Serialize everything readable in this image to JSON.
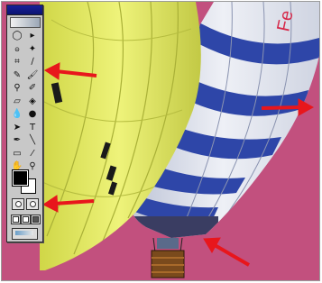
{
  "application": {
    "panel": "tools palette"
  },
  "toolbox": {
    "tools": [
      {
        "name": "marquee-tool-icon",
        "glyph": "◯"
      },
      {
        "name": "move-tool-icon",
        "glyph": "▸"
      },
      {
        "name": "lasso-tool-icon",
        "glyph": "ဓ"
      },
      {
        "name": "magic-wand-tool-icon",
        "glyph": "✦"
      },
      {
        "name": "crop-tool-icon",
        "glyph": "⌗"
      },
      {
        "name": "slice-tool-icon",
        "glyph": "∕"
      },
      {
        "name": "healing-brush-tool-icon",
        "glyph": "✎"
      },
      {
        "name": "brush-tool-icon",
        "glyph": "🖌"
      },
      {
        "name": "clone-stamp-tool-icon",
        "glyph": "⚲"
      },
      {
        "name": "history-brush-tool-icon",
        "glyph": "✐"
      },
      {
        "name": "eraser-tool-icon",
        "glyph": "▱"
      },
      {
        "name": "paint-bucket-tool-icon",
        "glyph": "◈"
      },
      {
        "name": "blur-tool-icon",
        "glyph": "💧"
      },
      {
        "name": "dodge-tool-icon",
        "glyph": "●"
      },
      {
        "name": "path-selection-tool-icon",
        "glyph": "➤"
      },
      {
        "name": "type-tool-icon",
        "glyph": "T"
      },
      {
        "name": "pen-tool-icon",
        "glyph": "✒"
      },
      {
        "name": "line-tool-icon",
        "glyph": "╲"
      },
      {
        "name": "notes-tool-icon",
        "glyph": "▭"
      },
      {
        "name": "eyedropper-tool-icon",
        "glyph": "⁄"
      },
      {
        "name": "hand-tool-icon",
        "glyph": "✋"
      },
      {
        "name": "zoom-tool-icon",
        "glyph": "⚲"
      }
    ],
    "foreground_color": "#000000",
    "background_color": "#ffffff"
  },
  "canvas": {
    "background_color": "#c2507e",
    "yellow_balloon_color": "#e9f06a",
    "striped_balloon_colors": [
      "#e9ecf4",
      "#2e46a8"
    ],
    "balloon_lettering_visible": "Fe",
    "annotation_arrow_color": "#e8161c",
    "annotation_arrows": 4
  }
}
